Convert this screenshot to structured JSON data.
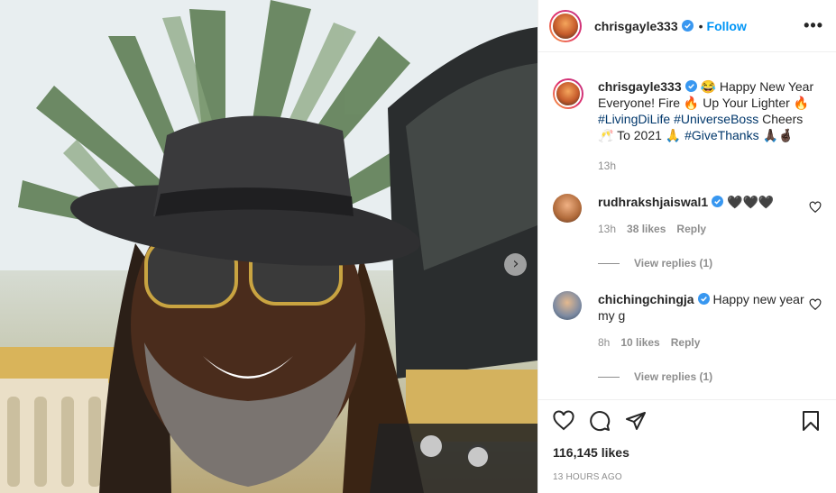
{
  "header": {
    "username": "chrisgayle333",
    "separator": "•",
    "follow_label": "Follow",
    "more_label": "•••"
  },
  "caption": {
    "username": "chrisgayle333",
    "text_1": " 😂 Happy New Year Everyone! Fire 🔥 Up Your Lighter 🔥 ",
    "tag_1": "#LivingDiLife",
    "tag_2": "#UniverseBoss",
    "text_2": " Cheers 🥂 To 2021 🙏 ",
    "tag_3": "#GiveThanks",
    "text_3": " 🙏🏿🤞🏿",
    "time": "13h"
  },
  "comments": [
    {
      "username": "rudhrakshjaiswal1",
      "text": " 🖤🖤🖤",
      "time": "13h",
      "likes": "38 likes",
      "reply_label": "Reply",
      "view_replies": "View replies (1)"
    },
    {
      "username": "chichingchingja",
      "text": " Happy new year my g",
      "time": "8h",
      "likes": "10 likes",
      "reply_label": "Reply",
      "view_replies": "View replies (1)"
    }
  ],
  "footer": {
    "likes": "116,145 likes",
    "posted": "13 HOURS AGO"
  },
  "photo": {
    "next_label": "›"
  },
  "colors": {
    "accent": "#0095f6",
    "verified": "#3897f0",
    "muted": "#8e8e8e",
    "hashtag": "#00376b"
  }
}
